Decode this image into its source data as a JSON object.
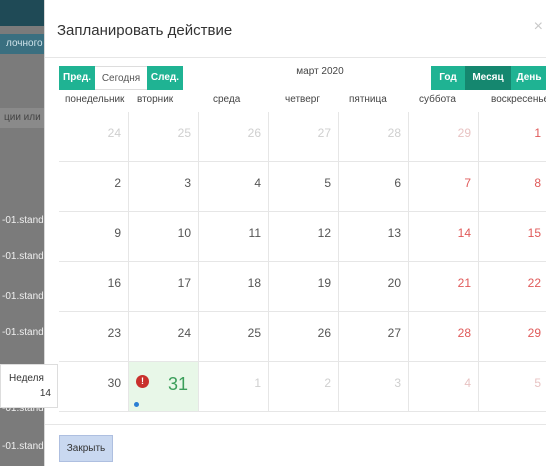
{
  "background": {
    "crumb": "лочного",
    "search_placeholder": "ции или",
    "rows": [
      "-01.stand",
      "-01.stand",
      "-01.stand",
      "-01.stand",
      "-01.stand",
      "-01.stand",
      "-01.stand"
    ]
  },
  "modal": {
    "title": "Запланировать действие",
    "close_glyph": "×",
    "nav": {
      "prev": "Пред.",
      "today": "Сегодня",
      "next": "След."
    },
    "period": "март 2020",
    "views": {
      "year": "Год",
      "month": "Месяц",
      "day": "День"
    },
    "weekdays": [
      "понедельник",
      "вторник",
      "среда",
      "четверг",
      "пятница",
      "суббота",
      "воскресенье"
    ],
    "weeks": [
      [
        "24",
        "25",
        "26",
        "27",
        "28",
        "29",
        "1"
      ],
      [
        "2",
        "3",
        "4",
        "5",
        "6",
        "7",
        "8"
      ],
      [
        "9",
        "10",
        "11",
        "12",
        "13",
        "14",
        "15"
      ],
      [
        "16",
        "17",
        "18",
        "19",
        "20",
        "21",
        "22"
      ],
      [
        "23",
        "24",
        "25",
        "26",
        "27",
        "28",
        "29"
      ],
      [
        "30",
        "31",
        "1",
        "2",
        "3",
        "4",
        "5"
      ]
    ],
    "alert_glyph": "!",
    "week_tooltip": {
      "label": "Неделя",
      "number": "14"
    },
    "close_button": "Закрыть"
  }
}
